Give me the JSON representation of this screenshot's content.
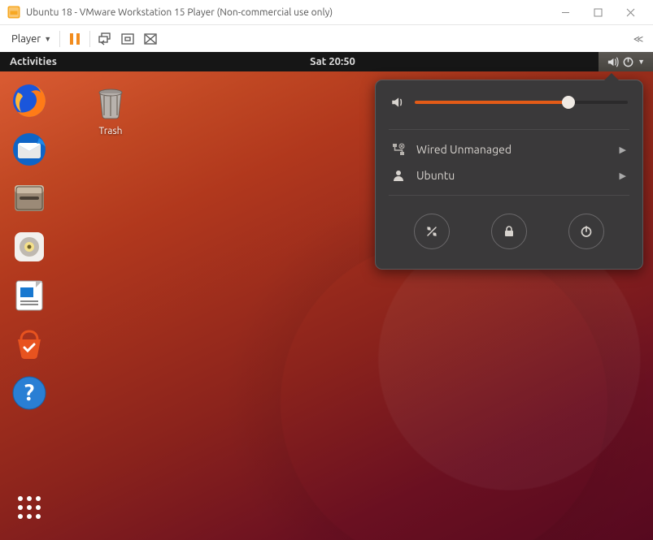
{
  "window": {
    "title": "Ubuntu 18 - VMware Workstation 15 Player (Non-commercial use only)",
    "player_label": "Player"
  },
  "topbar": {
    "activities": "Activities",
    "clock": "Sat 20:50"
  },
  "desktop": {
    "trash_label": "Trash"
  },
  "popover": {
    "volume_percent": 72,
    "network_label": "Wired Unmanaged",
    "user_label": "Ubuntu"
  },
  "dock": {
    "items": [
      "firefox",
      "thunderbird",
      "files",
      "rhythmbox",
      "libreoffice-writer",
      "ubuntu-software",
      "help"
    ]
  }
}
